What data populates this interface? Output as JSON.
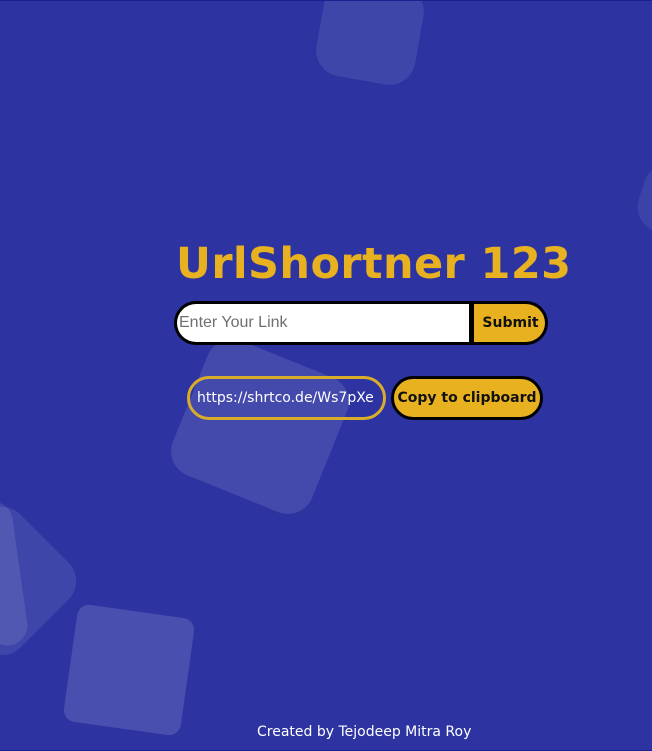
{
  "app": {
    "title": "UrlShortner 123"
  },
  "form": {
    "input_placeholder": "Enter Your Link",
    "input_value": "",
    "submit_label": "Submit"
  },
  "result": {
    "short_url": "https://shrtco.de/Ws7pXe",
    "copy_label": "Copy to clipboard"
  },
  "footer": {
    "credit": "Created by Tejodeep Mitra Roy"
  },
  "colors": {
    "background": "#2d34a2",
    "accent": "#e8b11f",
    "text_light": "#ffffff",
    "border_dark": "#000000"
  }
}
